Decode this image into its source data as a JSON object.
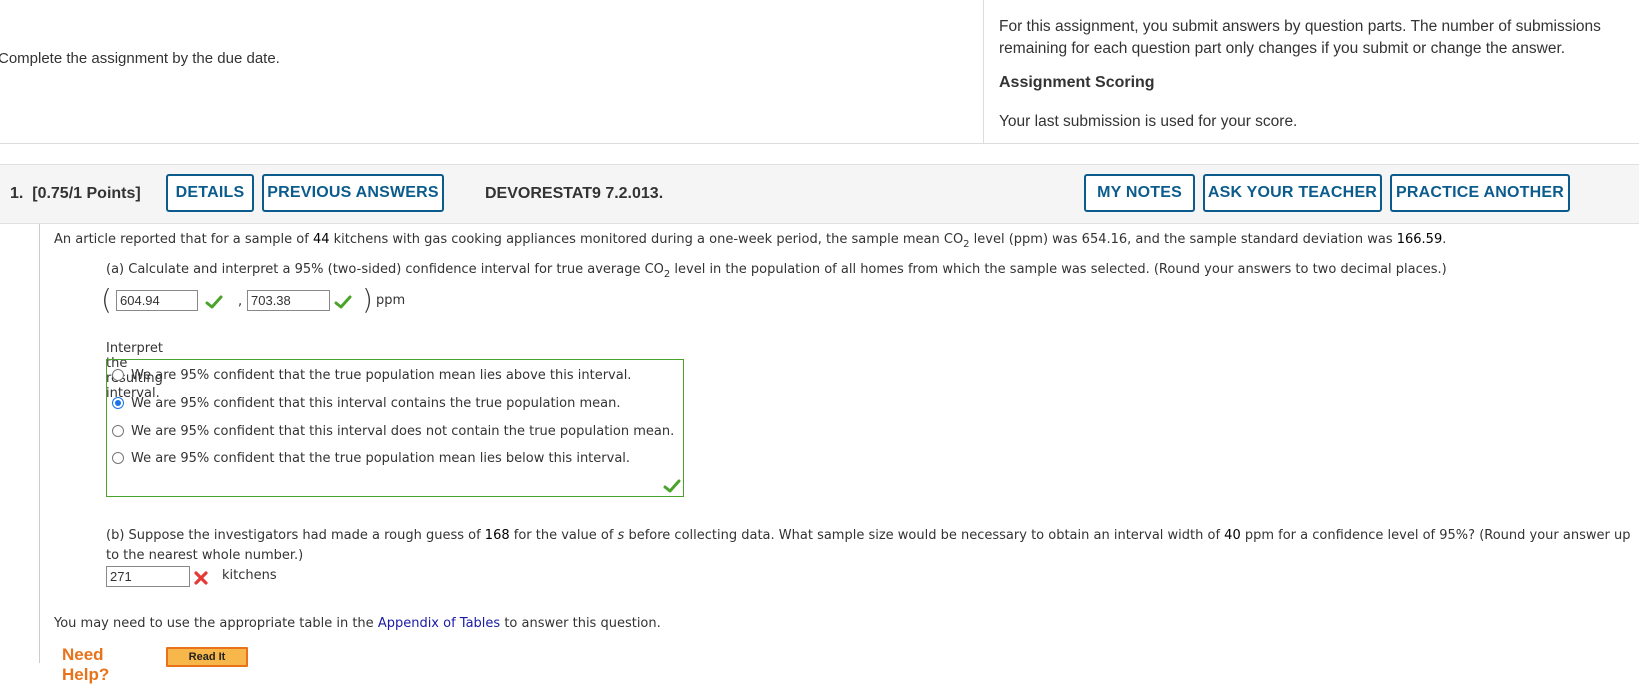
{
  "header_info": {
    "left_text": "Complete the assignment by the due date.",
    "submission_paragraph": "For this assignment, you submit answers by question parts. The number of submissions remaining for each question part only changes if you submit or change the answer.",
    "scoring_heading": "Assignment Scoring",
    "scoring_text": "Your last submission is used for your score."
  },
  "question": {
    "number": "1.",
    "points": "[0.75/1 Points]",
    "buttons": {
      "details": "DETAILS",
      "previous_answers": "PREVIOUS ANSWERS",
      "my_notes": "MY NOTES",
      "ask_teacher": "ASK YOUR TEACHER",
      "practice_another": "PRACTICE ANOTHER"
    },
    "code": "DEVORESTAT9 7.2.013.",
    "statement": {
      "pre": "An article reported that for a sample of ",
      "n": "44",
      "mid1": " kitchens with gas cooking appliances monitored during a one-week period, the sample mean CO",
      "sub": "2",
      "mid2": " level (ppm) was 654.16, and the sample standard deviation was ",
      "sd": "166.59",
      "post": "."
    },
    "part_a": {
      "pre": "(a) Calculate and interpret a 95% (two-sided) confidence interval for true average CO",
      "sub": "2",
      "post": " level in the population of all homes from which the sample was selected. (Round your answers to two decimal places.)",
      "lower_value": "604.94",
      "lower_status": "correct",
      "upper_value": "703.38",
      "upper_status": "correct",
      "comma": ",",
      "unit": "ppm",
      "interpret_label": "Interpret the resulting interval.",
      "options": [
        {
          "label": "We are 95% confident that the true population mean lies above this interval.",
          "selected": false
        },
        {
          "label": "We are 95% confident that this interval contains the true population mean.",
          "selected": true
        },
        {
          "label": "We are 95% confident that this interval does not contain the true population mean.",
          "selected": false
        },
        {
          "label": "We are 95% confident that the true population mean lies below this interval.",
          "selected": false
        }
      ],
      "mc_status": "correct"
    },
    "part_b": {
      "pre": "(b) Suppose the investigators had made a rough guess of ",
      "guess": "168",
      "mid1": " for the value of ",
      "var": "s",
      "mid2": " before collecting data. What sample size would be necessary to obtain an interval width of ",
      "width": "40",
      "post": " ppm for a confidence level of 95%? (Round your answer up to the nearest whole number.)",
      "answer_value": "271",
      "answer_status": "incorrect",
      "unit": "kitchens"
    },
    "appendix": {
      "pre": "You may need to use the appropriate table in the ",
      "link": "Appendix of Tables",
      "post": " to answer this question."
    },
    "help": {
      "label": "Need Help?",
      "read_it": "Read It"
    }
  },
  "colors": {
    "button_blue": "#0b5c8d",
    "correct_green": "#4aa32a",
    "incorrect_red": "#e53935",
    "help_orange": "#e8731a",
    "link_blue": "#1a1aa6"
  }
}
